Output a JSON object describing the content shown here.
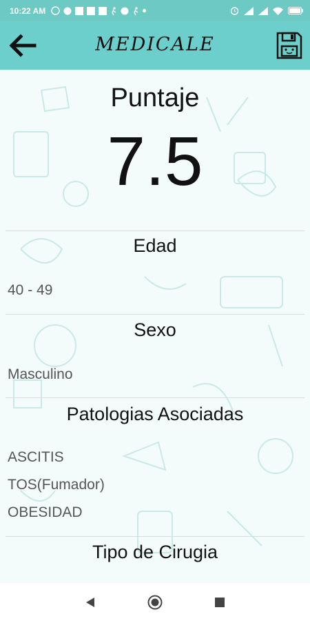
{
  "status_bar": {
    "time": "10:22 AM",
    "left_icons": [
      "whatsapp-icon",
      "chrome-icon",
      "facebook-icon",
      "facebook-icon",
      "facebook-icon",
      "walk-icon",
      "chrome-icon",
      "walk-icon",
      "notification-dot-icon"
    ],
    "right_icons": [
      "alarm-icon",
      "signal-icon",
      "signal-icon",
      "wifi-icon",
      "battery-icon"
    ]
  },
  "app_bar": {
    "title": "MEDICALE",
    "back_icon": "arrow-left-icon",
    "save_icon": "floppy-disk-icon",
    "color": "#6ccfcb"
  },
  "score": {
    "label": "Puntaje",
    "value": "7.5"
  },
  "sections": {
    "edad": {
      "title": "Edad",
      "value": "40 - 49"
    },
    "sexo": {
      "title": "Sexo",
      "value": "Masculino"
    },
    "patologias": {
      "title": "Patologias Asociadas",
      "values": [
        "ASCITIS",
        "TOS(Fumador)",
        "OBESIDAD"
      ]
    },
    "cirugia": {
      "title": "Tipo de Cirugia"
    }
  },
  "nav_bar": {
    "buttons": [
      "back-triangle-icon",
      "home-circle-icon",
      "recents-square-icon"
    ]
  }
}
